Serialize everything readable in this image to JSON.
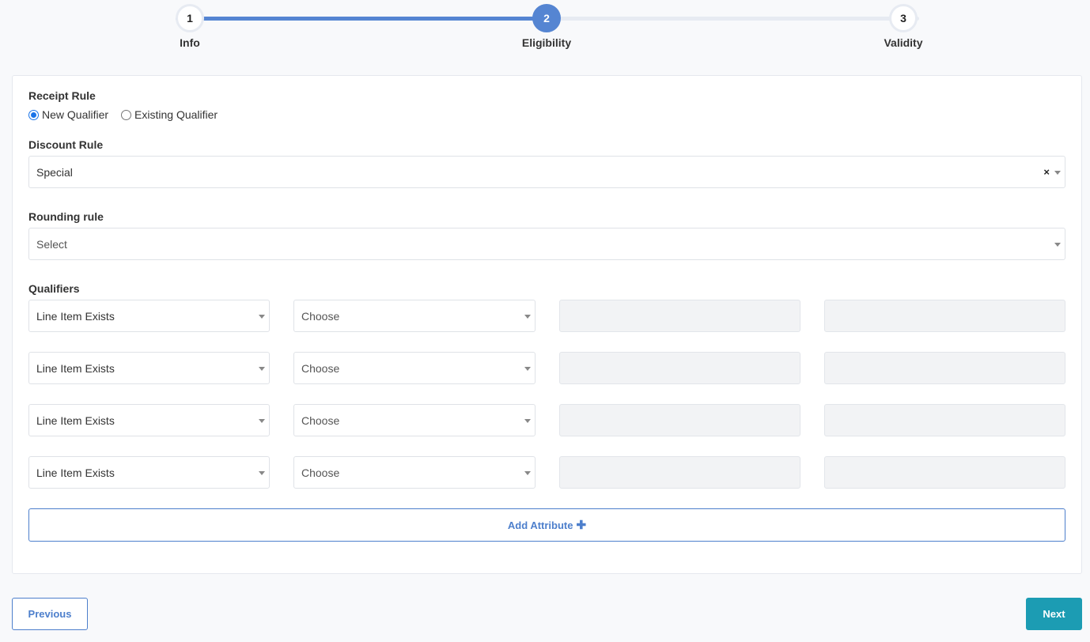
{
  "stepper": {
    "steps": [
      {
        "number": "1",
        "label": "Info",
        "state": "done"
      },
      {
        "number": "2",
        "label": "Eligibility",
        "state": "active"
      },
      {
        "number": "3",
        "label": "Validity",
        "state": "pending"
      }
    ],
    "accent": "#5585d2"
  },
  "receipt_rule": {
    "label": "Receipt Rule",
    "options": [
      "New Qualifier",
      "Existing Qualifier"
    ],
    "selected": "New Qualifier"
  },
  "discount_rule": {
    "label": "Discount Rule",
    "value": "Special",
    "clear_icon": "×"
  },
  "rounding_rule": {
    "label": "Rounding rule",
    "placeholder": "Select"
  },
  "qualifiers": {
    "label": "Qualifiers",
    "rows": [
      {
        "type": "Line Item Exists",
        "operator": "Choose"
      },
      {
        "type": "Line Item Exists",
        "operator": "Choose"
      },
      {
        "type": "Line Item Exists",
        "operator": "Choose"
      },
      {
        "type": "Line Item Exists",
        "operator": "Choose"
      }
    ]
  },
  "add_attribute": {
    "label": "Add Attribute",
    "icon": "plus-icon"
  },
  "nav": {
    "previous": "Previous",
    "next": "Next",
    "next_color": "#1c9cb3"
  }
}
